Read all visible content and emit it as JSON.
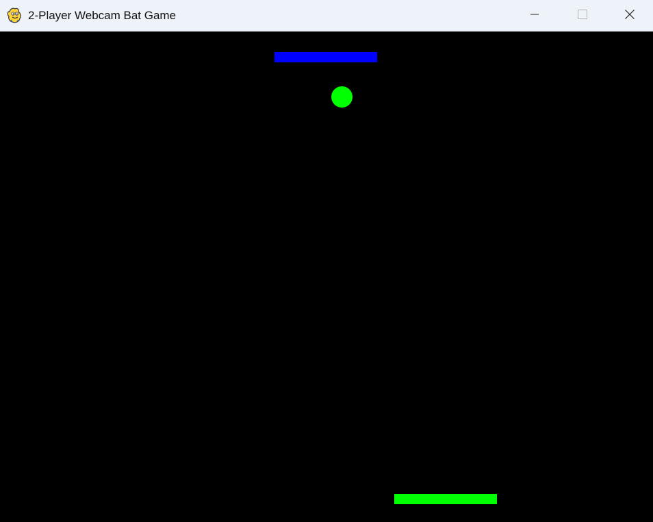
{
  "window": {
    "title": "2-Player Webcam Bat Game",
    "app_icon": "pygame-snake-icon",
    "controls": {
      "minimize_icon": "minimize-icon",
      "maximize_icon": "maximize-icon",
      "close_icon": "close-icon"
    }
  },
  "game": {
    "background_color": "#000000",
    "top_bat": {
      "player": "top",
      "color": "#0000ff"
    },
    "bottom_bat": {
      "player": "bottom",
      "color": "#00ff00"
    },
    "ball": {
      "color": "#00ff00"
    }
  }
}
